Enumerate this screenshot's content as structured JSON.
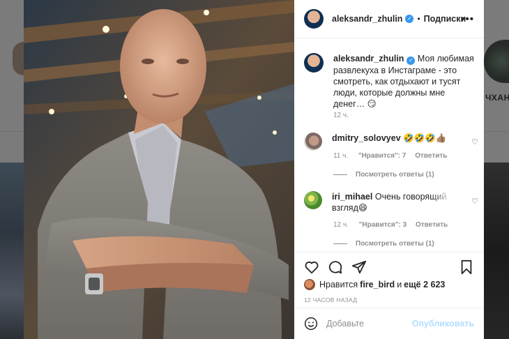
{
  "post": {
    "username": "aleksandr_zhulin",
    "follow_separator": "•",
    "follow_label": "Подписки",
    "more_label": "•••",
    "caption_text": "Моя любимая развлекуха в Инстаграме - это смотреть, как отдыхают и тусят люди, которые должны мне денег… 😏",
    "caption_time": "12 ч."
  },
  "comments": [
    {
      "username": "dmitry_solovyev",
      "text": "🤣🤣🤣👍🏽",
      "time": "11 ч.",
      "likes": "\"Нравится\": 7",
      "reply_label": "Ответить",
      "view_replies": "Посмотреть ответы (1)"
    },
    {
      "username": "iri_mihael",
      "text": "Очень говорящий взгляд😄",
      "time": "12 ч.",
      "likes": "\"Нравится\": 3",
      "reply_label": "Ответить",
      "view_replies": "Посмотреть ответы (1)"
    }
  ],
  "likes": {
    "prefix": "Нравится",
    "user": "fire_bird",
    "middle": "и",
    "count_text": "ещё 2 623"
  },
  "post_time": "12 ЧАСОВ НАЗАД",
  "add_comment": {
    "placeholder": "Добавьте",
    "publish_label": "Опубликовать"
  },
  "background": {
    "right_name": "ЧХАН"
  },
  "icons": {
    "verified": "verified-check-icon",
    "like": "heart-icon",
    "comment": "comment-bubble-icon",
    "share": "paper-plane-icon",
    "save": "bookmark-icon",
    "emoji": "smiley-icon"
  },
  "colors": {
    "accent_blue": "#3897f0",
    "publish_disabled": "#b2dffc",
    "secondary_text": "#8e8e8e",
    "primary_text": "#262626"
  }
}
